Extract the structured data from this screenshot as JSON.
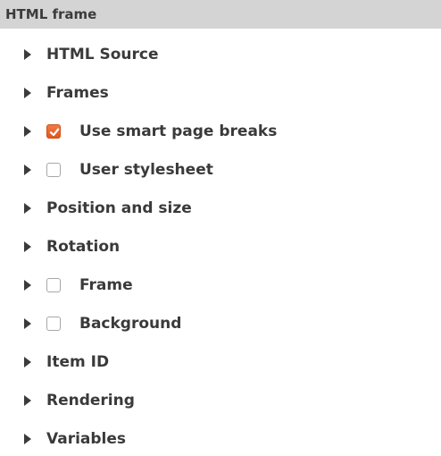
{
  "panel": {
    "title": "HTML frame"
  },
  "items": [
    {
      "label": "HTML Source",
      "has_checkbox": false
    },
    {
      "label": "Frames",
      "has_checkbox": false
    },
    {
      "label": "Use smart page breaks",
      "has_checkbox": true,
      "checked": true
    },
    {
      "label": "User stylesheet",
      "has_checkbox": true,
      "checked": false
    },
    {
      "label": "Position and size",
      "has_checkbox": false
    },
    {
      "label": "Rotation",
      "has_checkbox": false
    },
    {
      "label": "Frame",
      "has_checkbox": true,
      "checked": false
    },
    {
      "label": "Background",
      "has_checkbox": true,
      "checked": false
    },
    {
      "label": "Item ID",
      "has_checkbox": false
    },
    {
      "label": "Rendering",
      "has_checkbox": false
    },
    {
      "label": "Variables",
      "has_checkbox": false
    }
  ],
  "colors": {
    "header_bg": "#d4d4d4",
    "checkbox_checked": "#e95f22",
    "text": "#3a3a3a"
  }
}
